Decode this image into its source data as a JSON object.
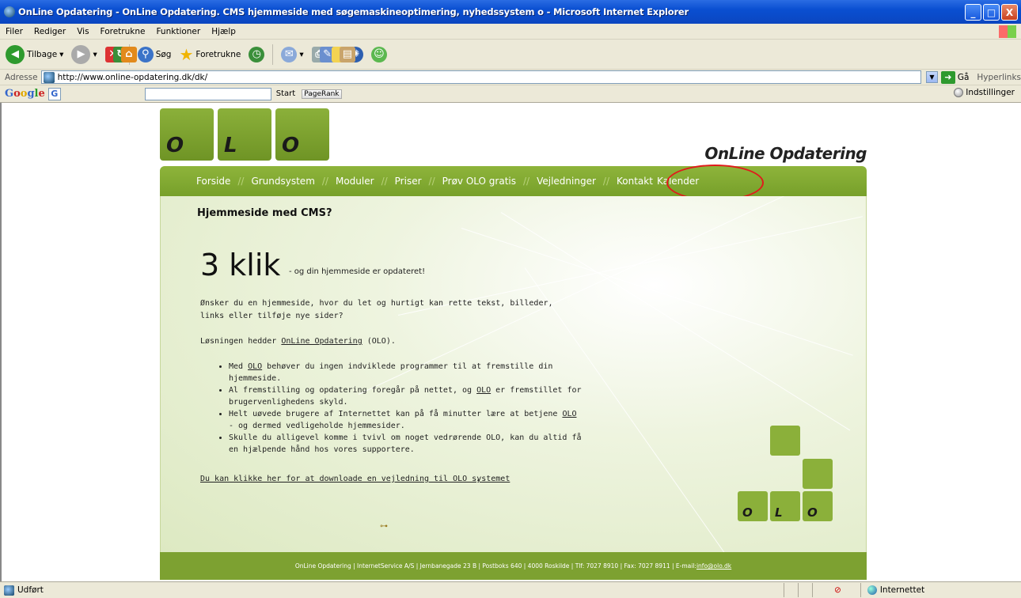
{
  "window": {
    "title": "OnLine Opdatering - OnLine Opdatering. CMS hjemmeside med søgemaskineoptimering, nyhedssystem o - Microsoft Internet Explorer",
    "buttons": [
      "_",
      "□",
      "X"
    ]
  },
  "menu": [
    "Filer",
    "Rediger",
    "Vis",
    "Foretrukne",
    "Funktioner",
    "Hjælp"
  ],
  "toolbar": {
    "back": "Tilbage",
    "search": "Søg",
    "favorites": "Foretrukne"
  },
  "address": {
    "label": "Adresse",
    "url": "http://www.online-opdatering.dk/dk/",
    "go": "Gå",
    "links": "Hyperlinks"
  },
  "googlebar": {
    "logo": [
      "G",
      "o",
      "o",
      "g",
      "l",
      "e"
    ],
    "g_button": "G",
    "start": "Start",
    "pagerank": "PageRank",
    "settings": "Indstillinger"
  },
  "site": {
    "logo_letters": [
      "O",
      "L",
      "O"
    ],
    "brand": "OnLine Opdatering",
    "nav": [
      "Forside",
      "Grundsystem",
      "Moduler",
      "Priser",
      "Prøv OLO gratis",
      "Vejledninger",
      "Kontakt",
      "Kalender"
    ],
    "nav_separator": "//",
    "heading": "Hjemmeside med CMS?",
    "big": "3 klik",
    "big_sub": "- og din hjemmeside er opdateret!",
    "intro": "Ønsker du en hjemmeside, hvor du let og hurtigt kan rette tekst, billeder, links eller tilføje nye sider?",
    "solution_pre": "Løsningen hedder ",
    "solution_link": "OnLine Opdatering",
    "solution_post": " (OLO).",
    "bullets": [
      {
        "pre": "Med ",
        "link": "OLO",
        "post": " behøver du ingen indviklede programmer til at fremstille din hjemmeside."
      },
      {
        "pre": "Al fremstilling og opdatering foregår på nettet, og ",
        "link": "OLO",
        "post": " er fremstillet for brugervenlighedens skyld."
      },
      {
        "pre": "Helt uøvede brugere af Internettet kan på få minutter lære at betjene ",
        "link": "OLO",
        "post": " - og dermed vedligeholde hjemmesider."
      },
      {
        "pre": "Skulle du alligevel komme i tvivl om noget vedrørende OLO, kan du altid få en hjælpende hånd hos vores supportere.",
        "link": "",
        "post": ""
      }
    ],
    "download_link": "Du kan klikke her for at downloade en vejledning til OLO systemet",
    "download_post": ".",
    "footer_text": "OnLine Opdatering | InternetService A/S | Jernbanegade 23 B | Postboks 640 | 4000 Roskilde | Tlf: 7027 8910 | Fax: 7027 8911 | E-mail: ",
    "footer_email": "info@olo.dk",
    "accent": "#7da131"
  },
  "status": {
    "text": "Udført",
    "zone": "Internettet"
  }
}
